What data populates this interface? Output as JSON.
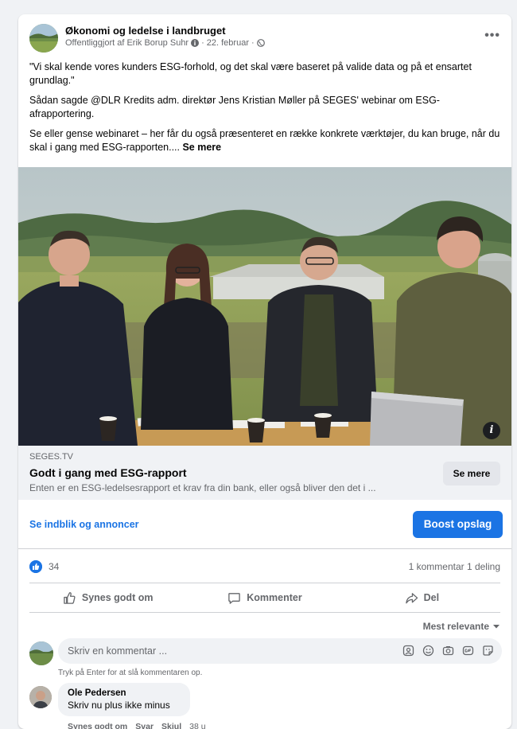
{
  "post": {
    "page_name": "Økonomi og ledelse i landbruget",
    "published_by": "Offentliggjort af Erik Borup Suhr",
    "date": "22. februar",
    "separator": "·",
    "more_label": "•••",
    "paragraphs": [
      "\"Vi skal kende vores kunders ESG-forhold, og det skal være baseret på valide data og på et ensartet grundlag.\"",
      "Sådan sagde @DLR Kredits adm. direktør Jens Kristian Møller på SEGES' webinar om ESG-afrapportering."
    ],
    "paragraph_last": "Se eller gense webinaret – her får du også præsenteret en række konkrete værktøjer, du kan bruge, når du skal i gang med ESG-rapporten....",
    "see_more_text": "Se mere"
  },
  "media": {
    "info_label": "i"
  },
  "link_preview": {
    "domain": "SEGES.TV",
    "title": "Godt i gang med ESG-rapport",
    "description": "Enten er en ESG-ledelsesrapport et krav fra din bank, eller også bliver den det i ...",
    "button_label": "Se mere"
  },
  "insights": {
    "link_label": "Se indblik og annoncer",
    "boost_label": "Boost opslag"
  },
  "counts": {
    "likes": "34",
    "comments_shares": "1 kommentar  1 deling"
  },
  "actions": {
    "like_label": "Synes godt om",
    "comment_label": "Kommenter",
    "share_label": "Del"
  },
  "sort": {
    "label": "Mest relevante"
  },
  "composer": {
    "placeholder": "Skriv en kommentar ...",
    "hint": "Tryk på Enter for at slå kommentaren op."
  },
  "comment": {
    "author": "Ole Pedersen",
    "text": "Skriv nu plus ikke minus",
    "like_label": "Synes godt om",
    "reply_label": "Svar",
    "hide_label": "Skjul",
    "time": "38 u"
  },
  "colors": {
    "accent": "#1b74e4",
    "text_primary": "#050505",
    "text_secondary": "#65676b",
    "surface": "#f0f2f5"
  }
}
